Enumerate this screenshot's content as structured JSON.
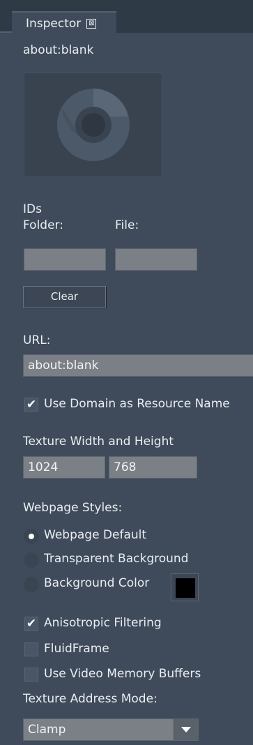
{
  "window": {
    "tab_title": "Inspector",
    "close_glyph": "⊠"
  },
  "header": {
    "page_title": "about:blank"
  },
  "preview": {
    "icon": "chrome-icon"
  },
  "ids": {
    "label": "IDs",
    "folder_label": "Folder:",
    "file_label": "File:",
    "folder_value": "",
    "file_value": "",
    "clear_label": "Clear"
  },
  "url": {
    "label": "URL:",
    "value": "about:blank",
    "use_domain_label": "Use Domain as Resource Name",
    "use_domain_checked": true
  },
  "texture": {
    "label": "Texture Width and Height",
    "width": "1024",
    "height": "768"
  },
  "styles": {
    "label": "Webpage Styles:",
    "options": [
      {
        "label": "Webpage Default",
        "selected": true
      },
      {
        "label": "Transparent Background",
        "selected": false
      },
      {
        "label": "Background Color",
        "selected": false
      }
    ],
    "background_color": "#000000"
  },
  "options": {
    "anisotropic_label": "Anisotropic Filtering",
    "anisotropic_checked": true,
    "fluidframe_label": "FluidFrame",
    "fluidframe_checked": false,
    "video_memory_label": "Use Video Memory Buffers",
    "video_memory_checked": false
  },
  "address_mode": {
    "label": "Texture Address Mode:",
    "value": "Clamp"
  },
  "colors": {
    "panel_bg": "#3f4b5a",
    "topbar_bg": "#2f3a47",
    "field_bg": "#7b7f86",
    "text": "#e9edf2"
  }
}
